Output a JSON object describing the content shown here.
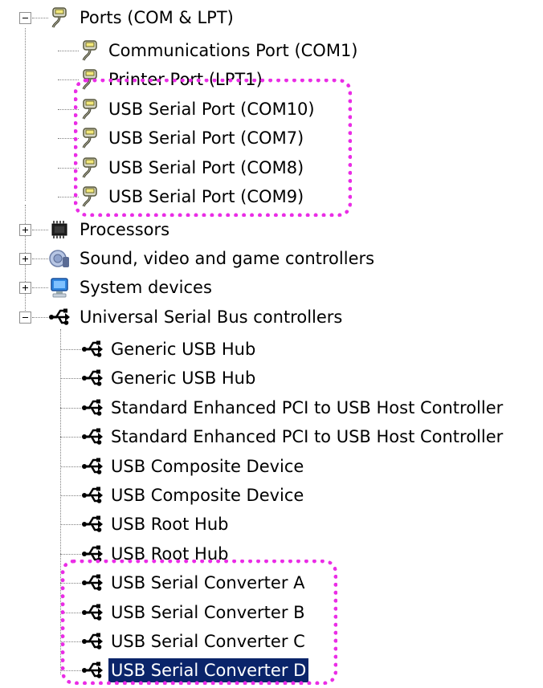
{
  "tree": {
    "ports": {
      "label": "Ports (COM & LPT)",
      "expanded": true,
      "icon": "port-connector-icon",
      "children": [
        {
          "label": "Communications Port (COM1)",
          "icon": "port-connector-icon"
        },
        {
          "label": "Printer Port (LPT1)",
          "icon": "port-connector-icon"
        },
        {
          "label": "USB Serial Port (COM10)",
          "icon": "port-connector-icon"
        },
        {
          "label": "USB Serial Port (COM7)",
          "icon": "port-connector-icon"
        },
        {
          "label": "USB Serial Port (COM8)",
          "icon": "port-connector-icon"
        },
        {
          "label": "USB Serial Port (COM9)",
          "icon": "port-connector-icon"
        }
      ]
    },
    "processors": {
      "label": "Processors",
      "expanded": false,
      "icon": "processor-chip-icon"
    },
    "sound": {
      "label": "Sound, video and game controllers",
      "expanded": false,
      "icon": "speaker-icon"
    },
    "system": {
      "label": "System devices",
      "expanded": false,
      "icon": "computer-icon"
    },
    "usb": {
      "label": "Universal Serial Bus controllers",
      "expanded": true,
      "icon": "usb-icon",
      "children": [
        {
          "label": "Generic USB Hub",
          "icon": "usb-icon"
        },
        {
          "label": "Generic USB Hub",
          "icon": "usb-icon"
        },
        {
          "label": "Standard Enhanced PCI to USB Host Controller",
          "icon": "usb-icon"
        },
        {
          "label": "Standard Enhanced PCI to USB Host Controller",
          "icon": "usb-icon"
        },
        {
          "label": "USB Composite Device",
          "icon": "usb-icon"
        },
        {
          "label": "USB Composite Device",
          "icon": "usb-icon"
        },
        {
          "label": "USB Root Hub",
          "icon": "usb-icon"
        },
        {
          "label": "USB Root Hub",
          "icon": "usb-icon"
        },
        {
          "label": "USB Serial Converter A",
          "icon": "usb-icon"
        },
        {
          "label": "USB Serial Converter B",
          "icon": "usb-icon"
        },
        {
          "label": "USB Serial Converter C",
          "icon": "usb-icon"
        },
        {
          "label": "USB Serial Converter D",
          "icon": "usb-icon",
          "selected": true
        }
      ]
    }
  },
  "annotation": {
    "color": "#ea2de6",
    "highlights": [
      "usb-serial-ports-highlight",
      "usb-serial-converters-highlight"
    ]
  },
  "colors": {
    "selection_bg": "#0a246a",
    "selection_text": "#ffffff",
    "tree_lines": "#808080"
  }
}
